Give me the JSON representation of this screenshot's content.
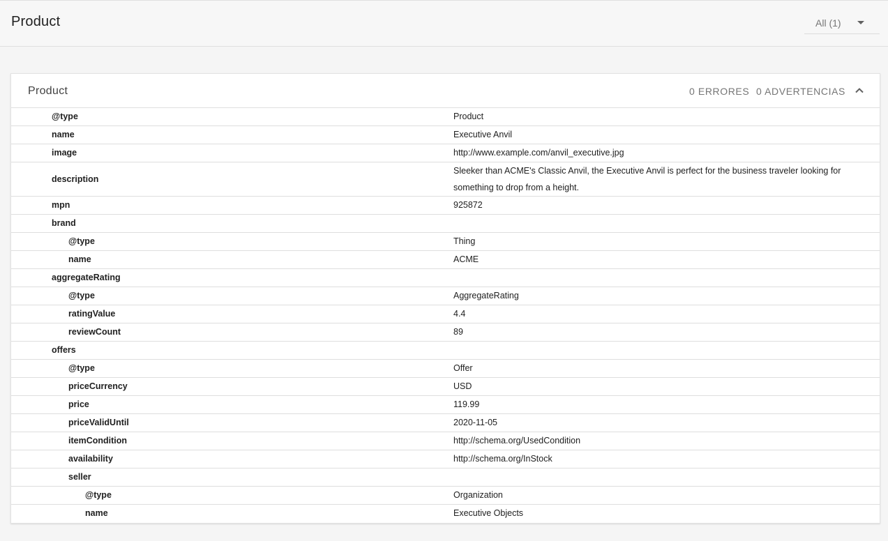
{
  "header": {
    "title": "Product",
    "filter_label": "All (1)"
  },
  "card": {
    "title": "Product",
    "errors": "0 ERRORES",
    "warnings": "0 ADVERTENCIAS"
  },
  "rows": [
    {
      "key": "@type",
      "value": "Product",
      "level": 0
    },
    {
      "key": "name",
      "value": "Executive Anvil",
      "level": 0
    },
    {
      "key": "image",
      "value": "http://www.example.com/anvil_executive.jpg",
      "level": 0
    },
    {
      "key": "description",
      "value": "Sleeker than ACME's Classic Anvil, the Executive Anvil is perfect for the business traveler looking for something to drop from a height.",
      "level": 0
    },
    {
      "key": "mpn",
      "value": "925872",
      "level": 0
    },
    {
      "key": "brand",
      "value": "",
      "level": 0
    },
    {
      "key": "@type",
      "value": "Thing",
      "level": 1
    },
    {
      "key": "name",
      "value": "ACME",
      "level": 1
    },
    {
      "key": "aggregateRating",
      "value": "",
      "level": 0
    },
    {
      "key": "@type",
      "value": "AggregateRating",
      "level": 1
    },
    {
      "key": "ratingValue",
      "value": "4.4",
      "level": 1
    },
    {
      "key": "reviewCount",
      "value": "89",
      "level": 1
    },
    {
      "key": "offers",
      "value": "",
      "level": 0
    },
    {
      "key": "@type",
      "value": "Offer",
      "level": 1
    },
    {
      "key": "priceCurrency",
      "value": "USD",
      "level": 1
    },
    {
      "key": "price",
      "value": "119.99",
      "level": 1
    },
    {
      "key": "priceValidUntil",
      "value": "2020-11-05",
      "level": 1
    },
    {
      "key": "itemCondition",
      "value": "http://schema.org/UsedCondition",
      "level": 1
    },
    {
      "key": "availability",
      "value": "http://schema.org/InStock",
      "level": 1
    },
    {
      "key": "seller",
      "value": "",
      "level": 1
    },
    {
      "key": "@type",
      "value": "Organization",
      "level": 2
    },
    {
      "key": "name",
      "value": "Executive Objects",
      "level": 2
    }
  ],
  "icons": {
    "filter_dropdown": "caret-down-icon",
    "collapse": "chevron-up-icon"
  }
}
